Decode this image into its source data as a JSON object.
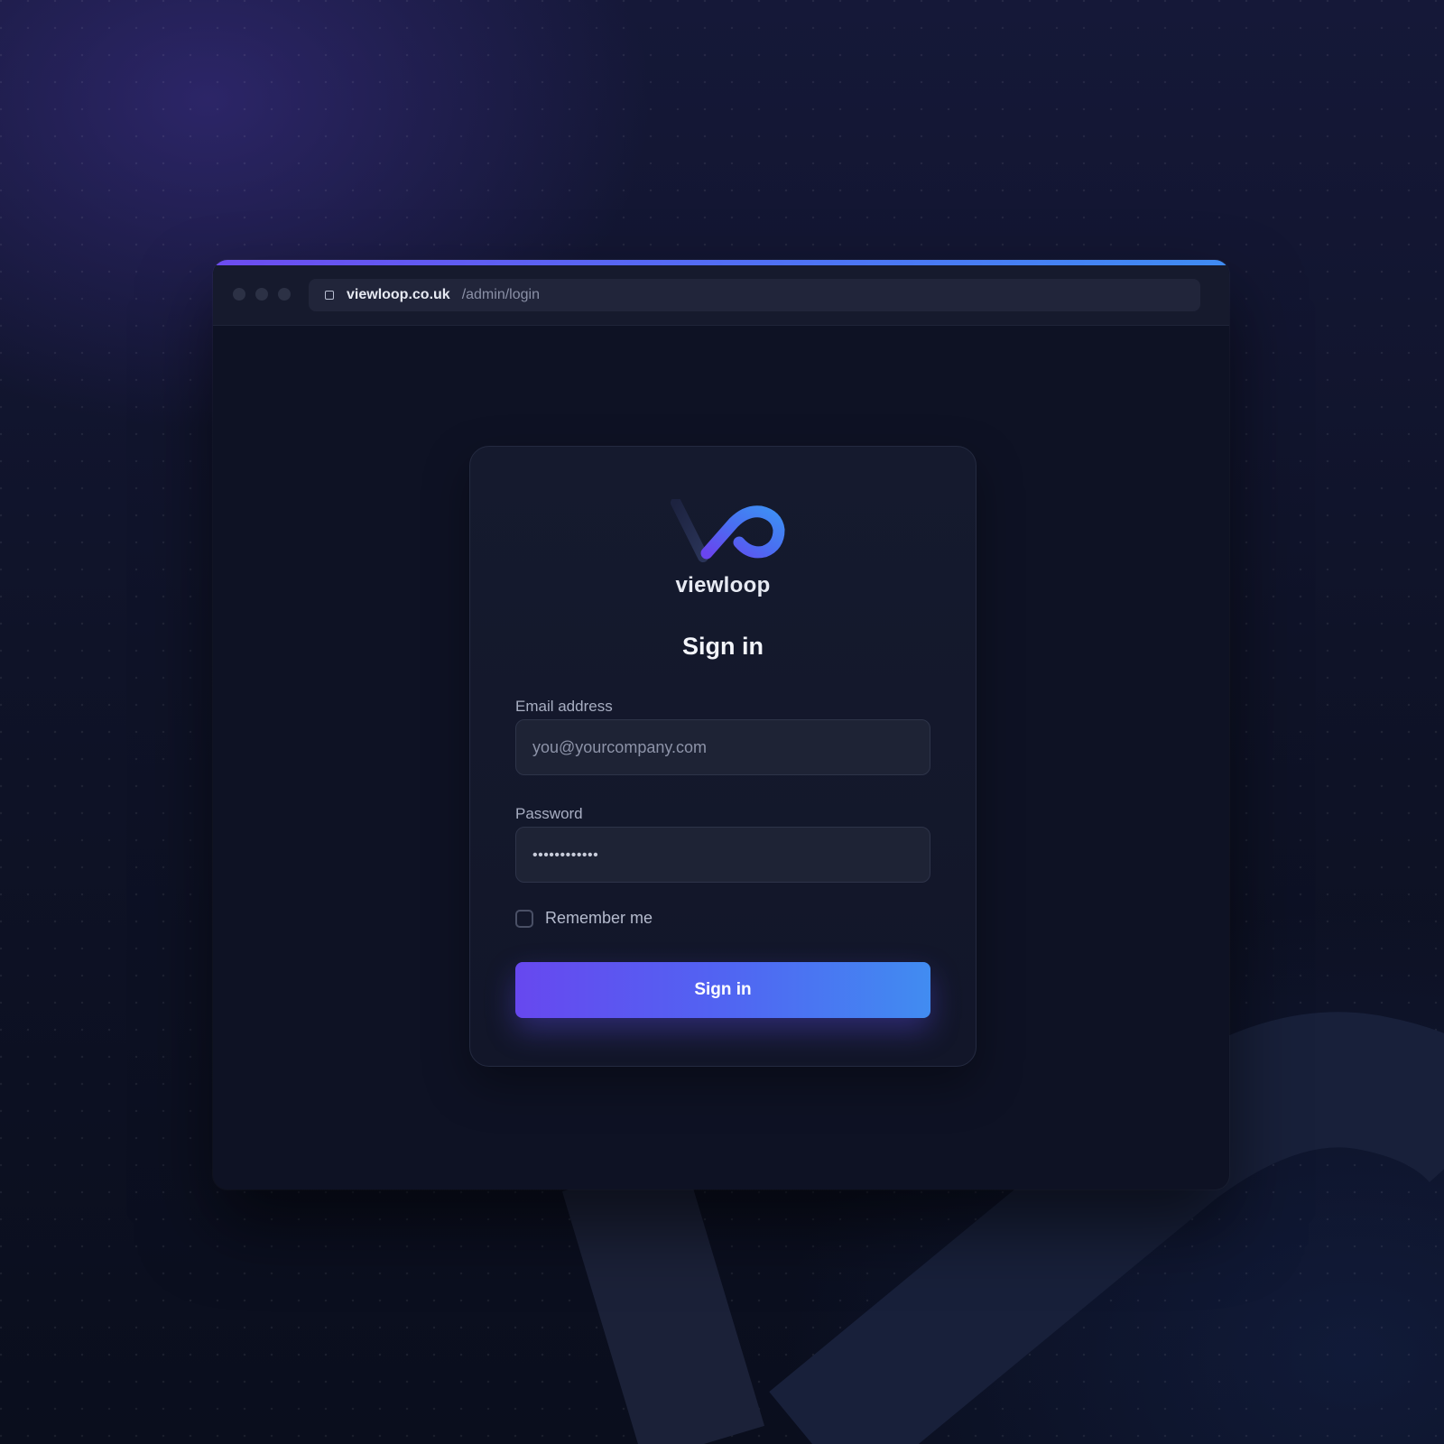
{
  "browser": {
    "url_domain": "viewloop.co.uk",
    "url_path": "/admin/login"
  },
  "brand": {
    "name": "viewloop",
    "logo_icon": "viewloop-logo-icon",
    "accent_start": "#6d4cf0",
    "accent_end": "#3f8cf3"
  },
  "login": {
    "title": "Sign in",
    "email_label": "Email address",
    "email_placeholder": "you@yourcompany.com",
    "password_label": "Password",
    "password_value": "••••••••••••",
    "remember_label": "Remember me",
    "remember_checked": false,
    "submit_label": "Sign in"
  }
}
